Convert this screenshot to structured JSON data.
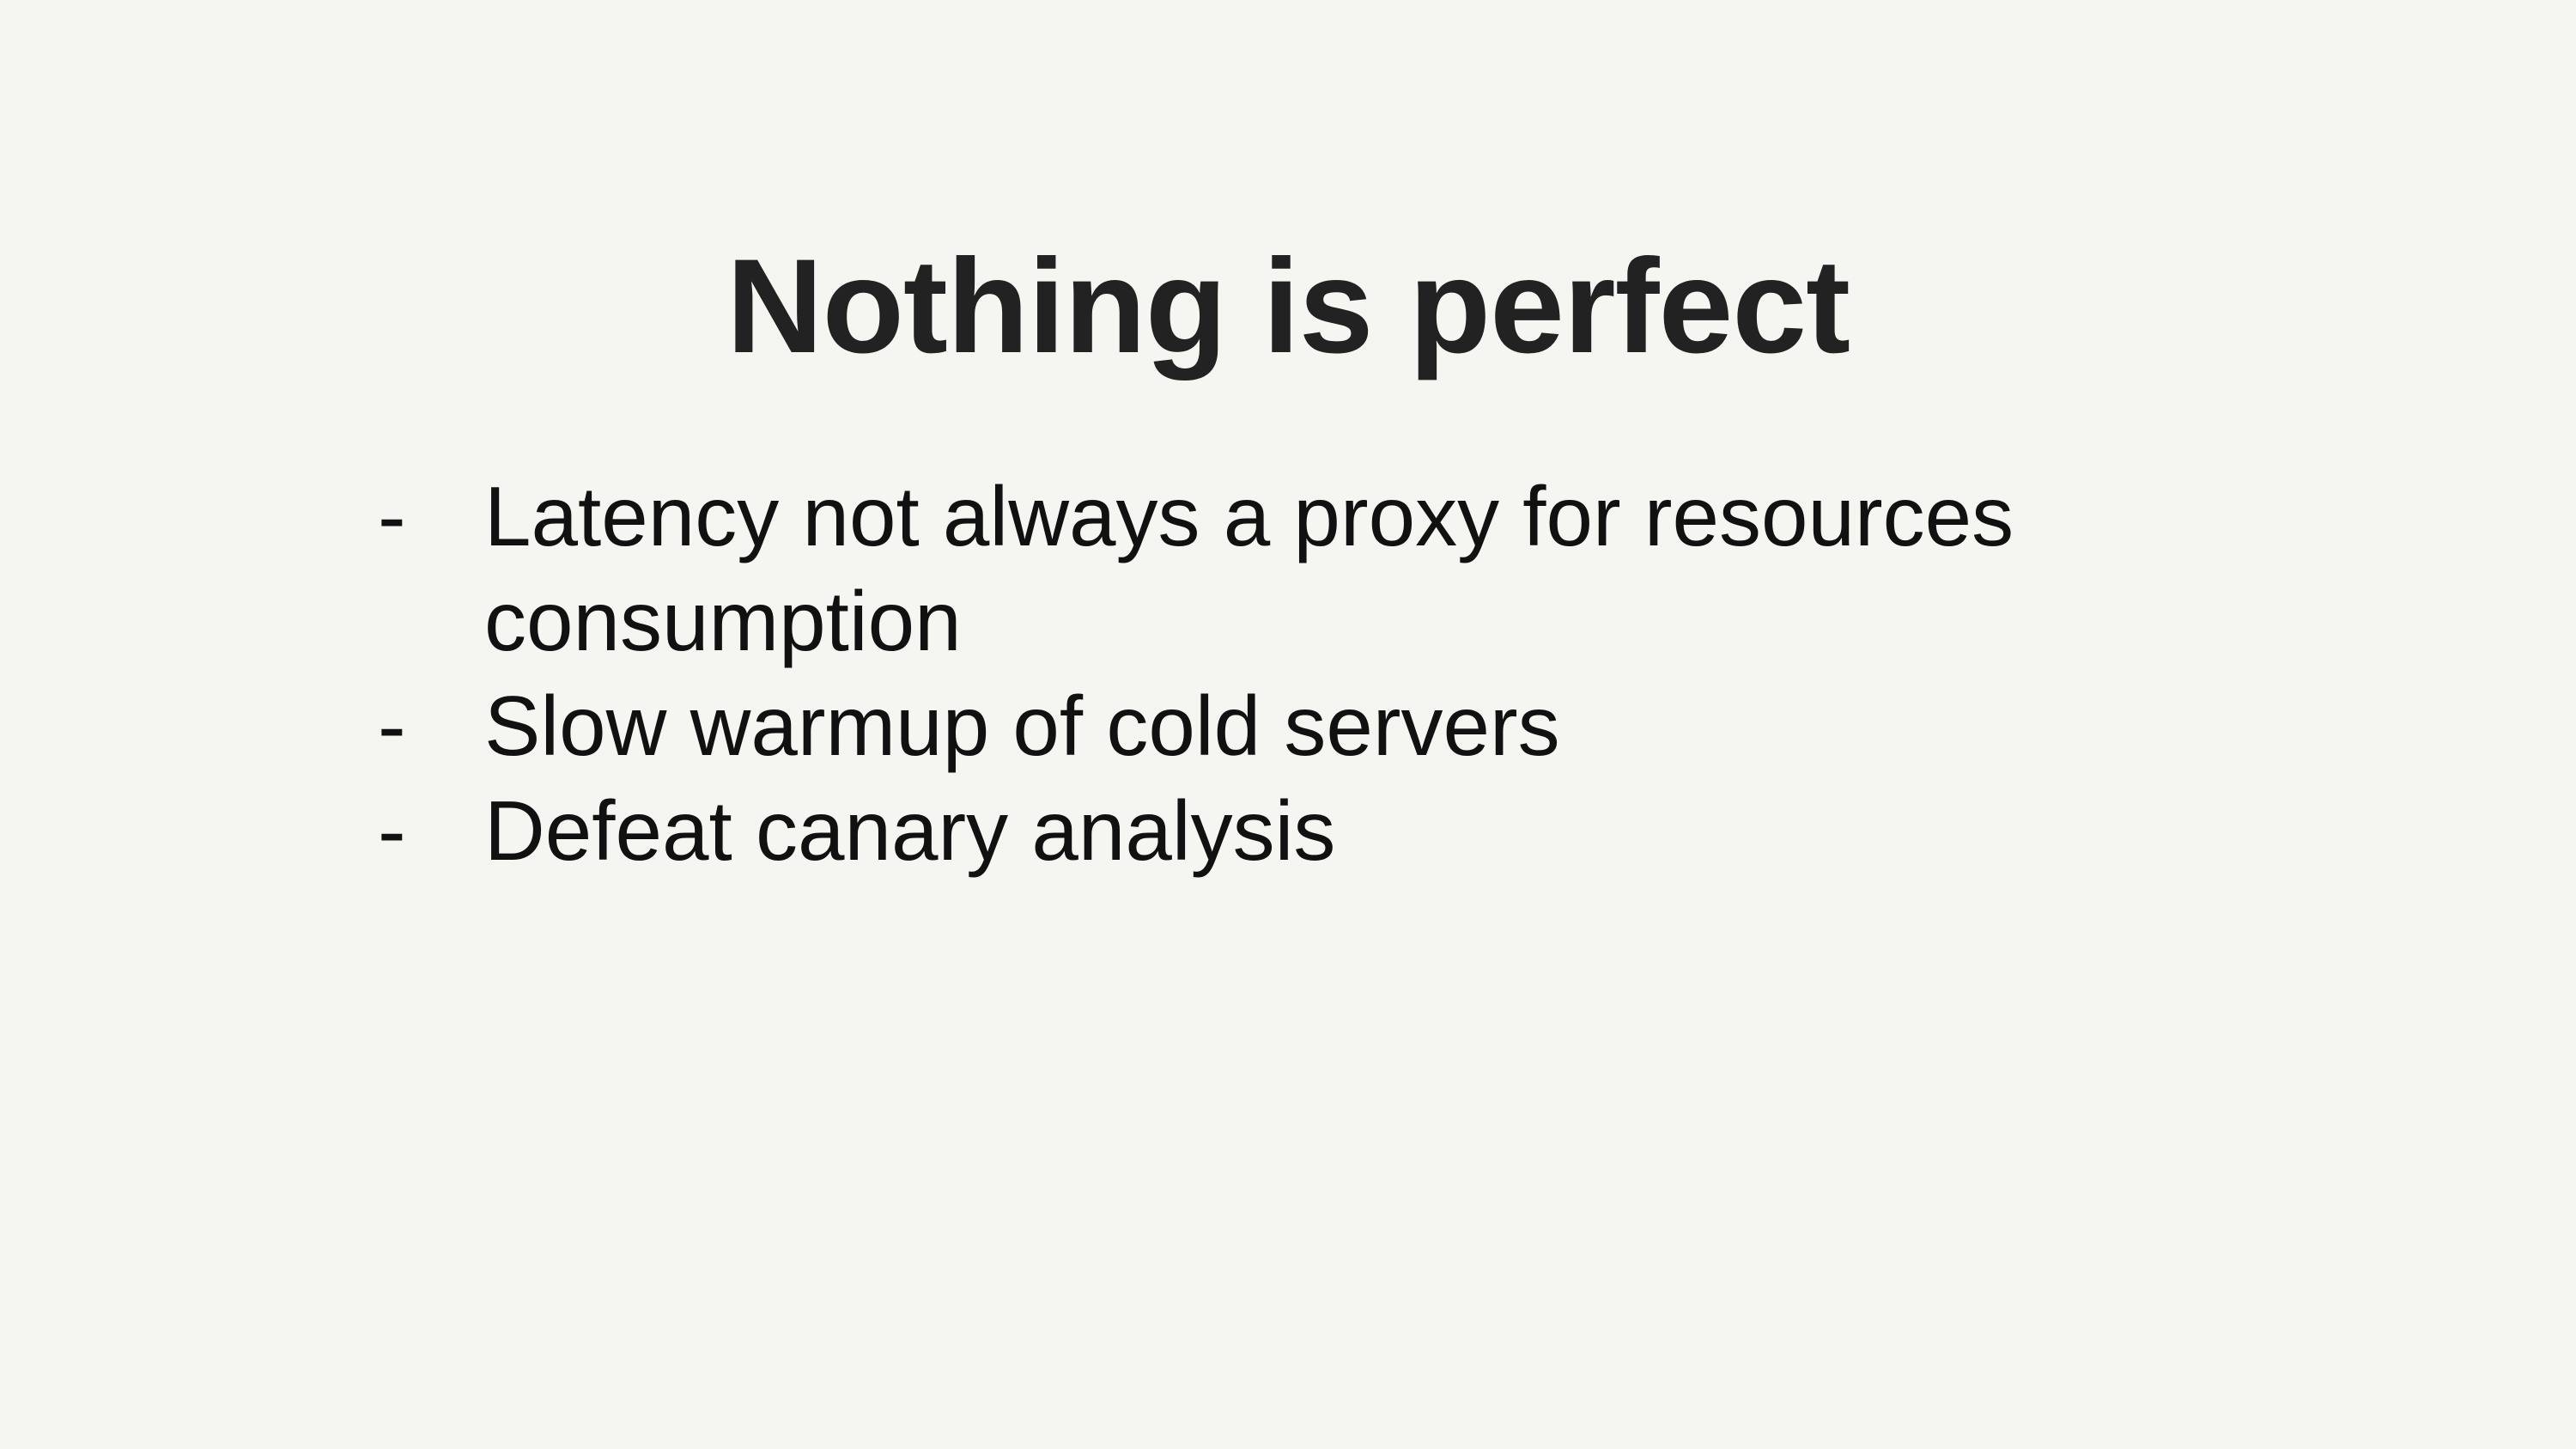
{
  "slide": {
    "title": "Nothing is perfect",
    "bullets": [
      {
        "marker": "-",
        "text": "Latency not always a proxy for resources consumption"
      },
      {
        "marker": "-",
        "text": "Slow warmup of cold servers"
      },
      {
        "marker": "-",
        "text": "Defeat canary analysis"
      }
    ]
  },
  "colors": {
    "background": "#f5f5f1",
    "title": "#222222",
    "text": "#111111"
  }
}
